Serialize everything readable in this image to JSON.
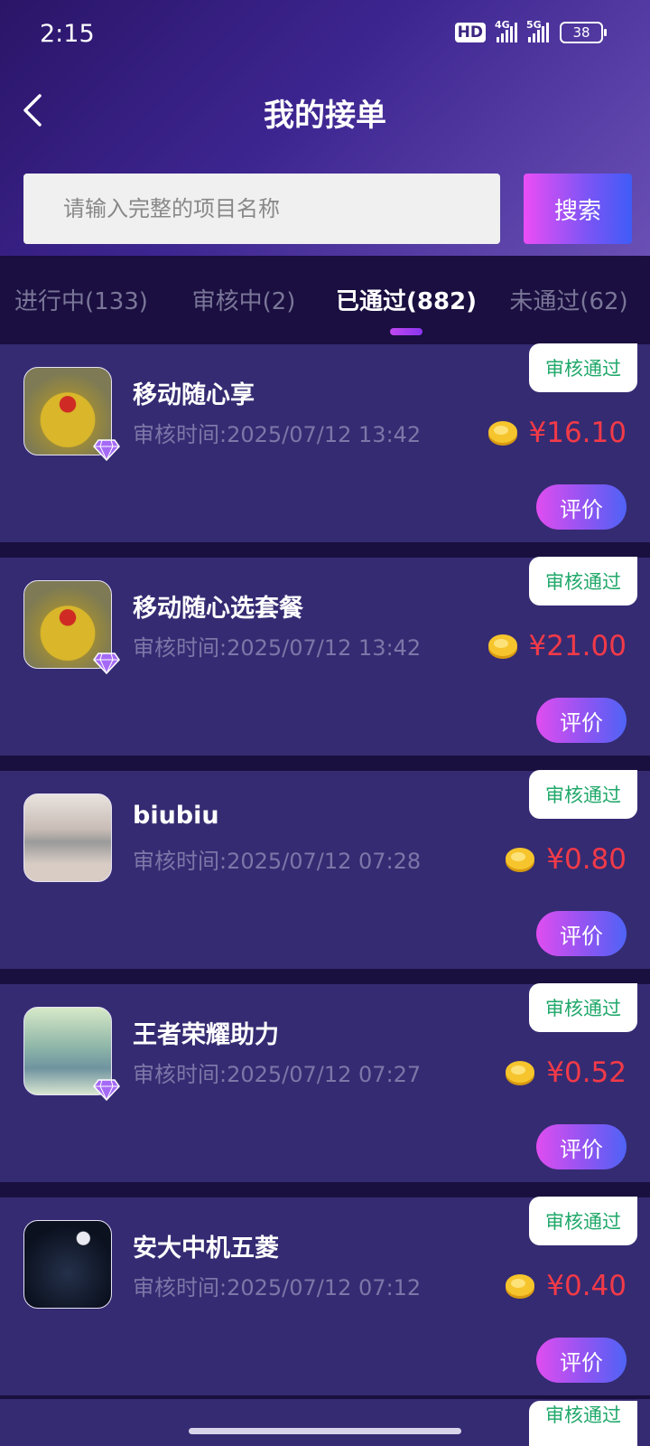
{
  "status_bar": {
    "time": "2:15",
    "hd": "HD",
    "net1": "4G",
    "net2": "5G",
    "battery": "38"
  },
  "nav": {
    "title": "我的接单"
  },
  "search": {
    "placeholder": "请输入完整的项目名称",
    "button": "搜索"
  },
  "tabs": [
    {
      "label": "进行中(133)",
      "active": false
    },
    {
      "label": "审核中(2)",
      "active": false
    },
    {
      "label": "已通过(882)",
      "active": true
    },
    {
      "label": "未通过(62)",
      "active": false
    }
  ],
  "orders": [
    {
      "title": "移动随心享",
      "time": "审核时间:2025/07/12 13:42",
      "status": "审核通过",
      "price": "¥16.10",
      "action": "评价",
      "avatar": "gold-figure-avatar",
      "vip": true
    },
    {
      "title": "移动随心选套餐",
      "time": "审核时间:2025/07/12 13:42",
      "status": "审核通过",
      "price": "¥21.00",
      "action": "评价",
      "avatar": "gold-figure-avatar",
      "vip": true
    },
    {
      "title": "biubiu",
      "time": "审核时间:2025/07/12 07:28",
      "status": "审核通过",
      "price": "¥0.80",
      "action": "评价",
      "avatar": "girl-photo-avatar",
      "vip": false
    },
    {
      "title": "王者荣耀助力",
      "time": "审核时间:2025/07/12 07:27",
      "status": "审核通过",
      "price": "¥0.52",
      "action": "评价",
      "avatar": "anime-boy-avatar",
      "vip": true
    },
    {
      "title": "安大中机五菱",
      "time": "审核时间:2025/07/12 07:12",
      "status": "审核通过",
      "price": "¥0.40",
      "action": "评价",
      "avatar": "night-moon-avatar",
      "vip": false
    }
  ],
  "peek_status": "审核通过",
  "colors": {
    "price": "#f23a48",
    "status_text": "#20a86a",
    "card_bg": "#352b72",
    "accent_pink": "#ec4df5",
    "accent_blue": "#3f5cf7"
  }
}
